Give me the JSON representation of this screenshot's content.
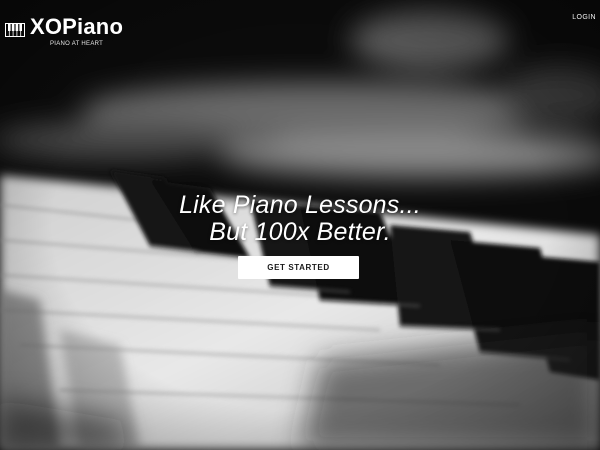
{
  "header": {
    "brand": "XOPiano",
    "tagline": "PIANO AT HEART",
    "login_label": "LOGIN"
  },
  "hero": {
    "headline_line1": "Like Piano Lessons...",
    "headline_line2": "But 100x Better.",
    "cta_label": "GET STARTED",
    "background": "blurred black-and-white piano keyboard photo"
  },
  "icons": {
    "logo": "piano-keys-icon"
  },
  "colors": {
    "text": "#ffffff",
    "button_bg": "#ffffff",
    "button_text": "#1a1a1a",
    "background": "#0c0c0c"
  }
}
